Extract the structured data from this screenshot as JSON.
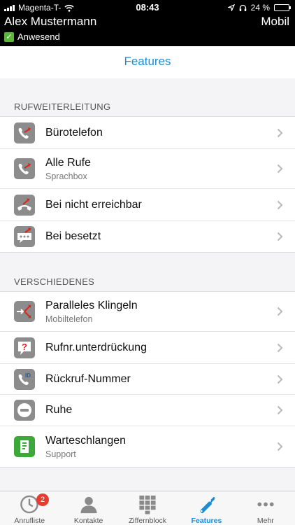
{
  "status_bar": {
    "carrier": "Magenta-T-",
    "time": "08:43",
    "battery": "24 %",
    "battery_level": 0.24
  },
  "user": {
    "name": "Alex Mustermann",
    "device": "Mobil",
    "presence": "Anwesend"
  },
  "header": {
    "title": "Features"
  },
  "sections": {
    "call_forwarding": {
      "title": "RUFWEITERLEITUNG",
      "items": [
        {
          "label": "Bürotelefon",
          "sub": ""
        },
        {
          "label": "Alle Rufe",
          "sub": "Sprachbox"
        },
        {
          "label": "Bei nicht erreichbar",
          "sub": ""
        },
        {
          "label": "Bei besetzt",
          "sub": ""
        }
      ]
    },
    "misc": {
      "title": "VERSCHIEDENES",
      "items": [
        {
          "label": "Paralleles Klingeln",
          "sub": "Mobiltelefon"
        },
        {
          "label": "Rufnr.unterdrückung",
          "sub": ""
        },
        {
          "label": "Rückruf-Nummer",
          "sub": ""
        },
        {
          "label": "Ruhe",
          "sub": ""
        },
        {
          "label": "Warteschlangen",
          "sub": "Support"
        }
      ]
    }
  },
  "tabbar": {
    "tabs": [
      {
        "label": "Anrufliste",
        "badge": "2"
      },
      {
        "label": "Kontakte"
      },
      {
        "label": "Ziffernblock"
      },
      {
        "label": "Features"
      },
      {
        "label": "Mehr"
      }
    ],
    "active_color": "#1d8dd0"
  }
}
